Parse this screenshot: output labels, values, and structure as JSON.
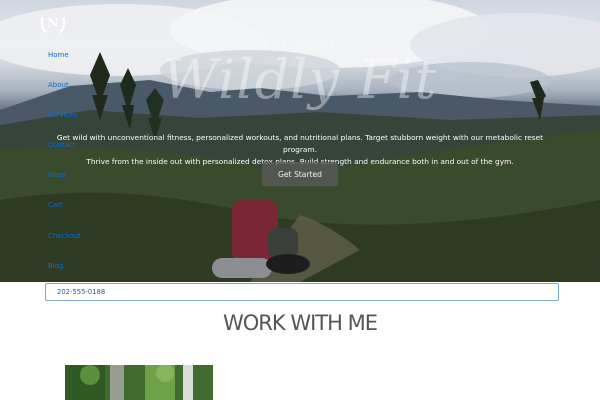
{
  "logo": {
    "letter": "N",
    "icon": "laurel-wreath-icon"
  },
  "nav": {
    "items": [
      {
        "label": "Home"
      },
      {
        "label": "About"
      },
      {
        "label": "Services"
      },
      {
        "label": "Contact"
      },
      {
        "label": "Shop"
      },
      {
        "label": "Cart"
      },
      {
        "label": "Checkout"
      },
      {
        "label": "Blog"
      }
    ]
  },
  "hero": {
    "kicker": "Let's get",
    "title": "Wildly Fit",
    "line1": "Get wild with unconventional fitness, personalized workouts, and nutritional plans. Target stubborn weight with our metabolic reset program.",
    "line2": "Thrive from the inside out with personalized detox plans. Build strength and endurance both in and out of the gym.",
    "button_label": "Get Started"
  },
  "contact": {
    "phone": "202-555-0188"
  },
  "section": {
    "title": "WORK WITH ME"
  },
  "colors": {
    "nav_link": "#0a6cd6",
    "button_bg": "#5a5a5a",
    "phone_border": "#7fa7d6",
    "section_title": "#555555"
  }
}
